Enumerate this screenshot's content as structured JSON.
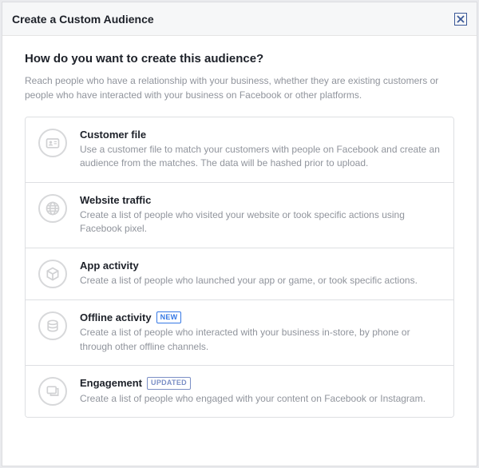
{
  "header": {
    "title": "Create a Custom Audience"
  },
  "body": {
    "question": "How do you want to create this audience?",
    "subtitle": "Reach people who have a relationship with your business, whether they are existing customers or people who have interacted with your business on Facebook or other platforms."
  },
  "options": [
    {
      "icon": "id-card",
      "title": "Customer file",
      "badge": null,
      "description": "Use a customer file to match your customers with people on Facebook and create an audience from the matches. The data will be hashed prior to upload."
    },
    {
      "icon": "globe",
      "title": "Website traffic",
      "badge": null,
      "description": "Create a list of people who visited your website or took specific actions using Facebook pixel."
    },
    {
      "icon": "cube",
      "title": "App activity",
      "badge": null,
      "description": "Create a list of people who launched your app or game, or took specific actions."
    },
    {
      "icon": "offline",
      "title": "Offline activity",
      "badge": "NEW",
      "badgeKind": "new",
      "description": "Create a list of people who interacted with your business in-store, by phone or through other offline channels."
    },
    {
      "icon": "engagement",
      "title": "Engagement",
      "badge": "UPDATED",
      "badgeKind": "updated",
      "description": "Create a list of people who engaged with your content on Facebook or Instagram."
    }
  ]
}
